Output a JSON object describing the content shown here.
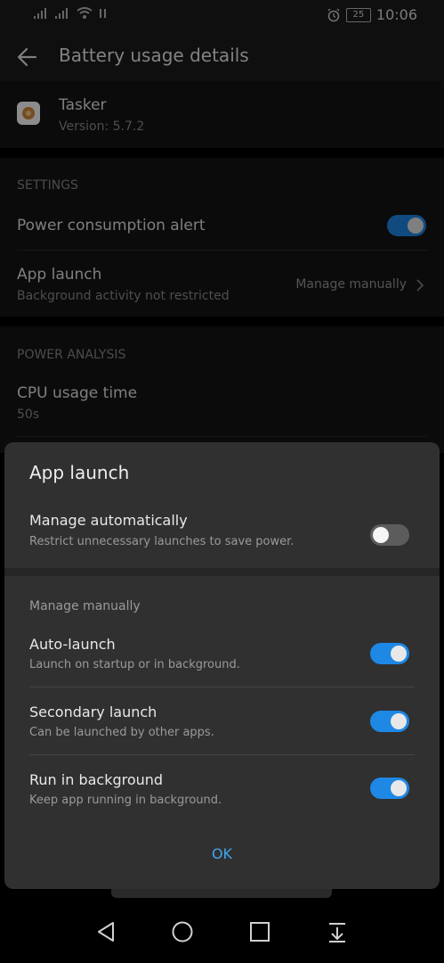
{
  "status": {
    "time": "10:06",
    "battery": "25"
  },
  "header": {
    "title": "Battery usage details"
  },
  "app": {
    "name": "Tasker",
    "version": "Version: 5.7.2"
  },
  "settings": {
    "header": "SETTINGS",
    "power_alert_label": "Power consumption alert",
    "power_alert_on": true,
    "app_launch_label": "App launch",
    "app_launch_sub": "Background activity not restricted",
    "app_launch_value": "Manage manually"
  },
  "power_analysis": {
    "header": "POWER ANALYSIS",
    "cpu_label": "CPU usage time",
    "cpu_value": "50s"
  },
  "dialog": {
    "title": "App launch",
    "auto_label": "Manage automatically",
    "auto_sub": "Restrict unnecessary launches to save power.",
    "auto_on": false,
    "manual_header": "Manage manually",
    "items": [
      {
        "label": "Auto-launch",
        "sub": "Launch on startup or in background.",
        "on": true
      },
      {
        "label": "Secondary launch",
        "sub": "Can be launched by other apps.",
        "on": true
      },
      {
        "label": "Run in background",
        "sub": "Keep app running in background.",
        "on": true
      }
    ],
    "ok_label": "OK"
  },
  "colors": {
    "accent": "#1e88e5",
    "ok": "#3fa6f0",
    "dialog_bg": "#303030",
    "page_bg": "#141414"
  }
}
